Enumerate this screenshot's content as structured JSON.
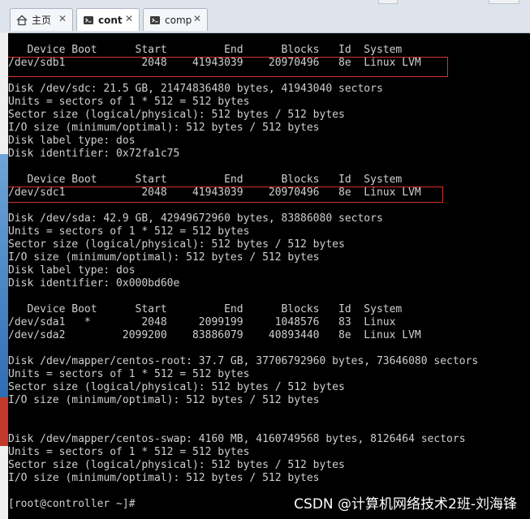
{
  "tabs": [
    {
      "label": "主页",
      "icon": "home-icon",
      "close": "✕"
    },
    {
      "label": "cont",
      "icon": "terminal-icon",
      "close": "✕"
    },
    {
      "label": "comp",
      "icon": "terminal-icon",
      "close": "✕"
    }
  ],
  "terminal": {
    "lines": [
      "   Device Boot      Start         End      Blocks   Id  System",
      "/dev/sdb1            2048    41943039    20970496   8e  Linux LVM",
      "",
      "Disk /dev/sdc: 21.5 GB, 21474836480 bytes, 41943040 sectors",
      "Units = sectors of 1 * 512 = 512 bytes",
      "Sector size (logical/physical): 512 bytes / 512 bytes",
      "I/O size (minimum/optimal): 512 bytes / 512 bytes",
      "Disk label type: dos",
      "Disk identifier: 0x72fa1c75",
      "",
      "   Device Boot      Start         End      Blocks   Id  System",
      "/dev/sdc1            2048    41943039    20970496   8e  Linux LVM",
      "",
      "Disk /dev/sda: 42.9 GB, 42949672960 bytes, 83886080 sectors",
      "Units = sectors of 1 * 512 = 512 bytes",
      "Sector size (logical/physical): 512 bytes / 512 bytes",
      "I/O size (minimum/optimal): 512 bytes / 512 bytes",
      "Disk label type: dos",
      "Disk identifier: 0x000bd60e",
      "",
      "   Device Boot      Start         End      Blocks   Id  System",
      "/dev/sda1   *        2048     2099199     1048576   83  Linux",
      "/dev/sda2         2099200    83886079    40893440   8e  Linux LVM",
      "",
      "Disk /dev/mapper/centos-root: 37.7 GB, 37706792960 bytes, 73646080 sectors",
      "Units = sectors of 1 * 512 = 512 bytes",
      "Sector size (logical/physical): 512 bytes / 512 bytes",
      "I/O size (minimum/optimal): 512 bytes / 512 bytes",
      "",
      "",
      "Disk /dev/mapper/centos-swap: 4160 MB, 4160749568 bytes, 8126464 sectors",
      "Units = sectors of 1 * 512 = 512 bytes",
      "Sector size (logical/physical): 512 bytes / 512 bytes",
      "I/O size (minimum/optimal): 512 bytes / 512 bytes",
      "",
      "[root@controller ~]#"
    ]
  },
  "watermark": "CSDN @计算机网络技术2班-刘海锋",
  "colors": {
    "terminal_bg": "#000000",
    "terminal_fg": "#cfcfcf",
    "highlight": "#d43030"
  }
}
